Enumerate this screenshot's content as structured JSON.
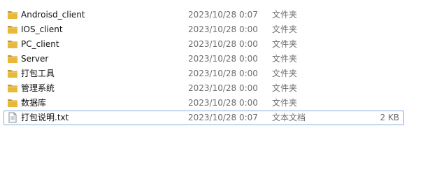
{
  "files": [
    {
      "name": "Androisd_client",
      "date": "2023/10/28 0:07",
      "type": "文件夹",
      "size": "",
      "icon": "folder-icon"
    },
    {
      "name": "IOS_client",
      "date": "2023/10/28 0:00",
      "type": "文件夹",
      "size": "",
      "icon": "folder-icon"
    },
    {
      "name": "PC_client",
      "date": "2023/10/28 0:00",
      "type": "文件夹",
      "size": "",
      "icon": "folder-icon"
    },
    {
      "name": "Server",
      "date": "2023/10/28 0:00",
      "type": "文件夹",
      "size": "",
      "icon": "folder-icon"
    },
    {
      "name": "打包工具",
      "date": "2023/10/28 0:00",
      "type": "文件夹",
      "size": "",
      "icon": "folder-icon"
    },
    {
      "name": "管理系统",
      "date": "2023/10/28 0:00",
      "type": "文件夹",
      "size": "",
      "icon": "folder-icon"
    },
    {
      "name": "数据库",
      "date": "2023/10/28 0:00",
      "type": "文件夹",
      "size": "",
      "icon": "folder-icon"
    },
    {
      "name": "打包说明.txt",
      "date": "2023/10/28 0:07",
      "type": "文本文档",
      "size": "2 KB",
      "icon": "text-file-icon"
    }
  ],
  "colors": {
    "folder": "#e8b83a",
    "folder_dark": "#c9952a",
    "selection_border": "#84acdd",
    "meta_text": "#6d6d6d"
  }
}
